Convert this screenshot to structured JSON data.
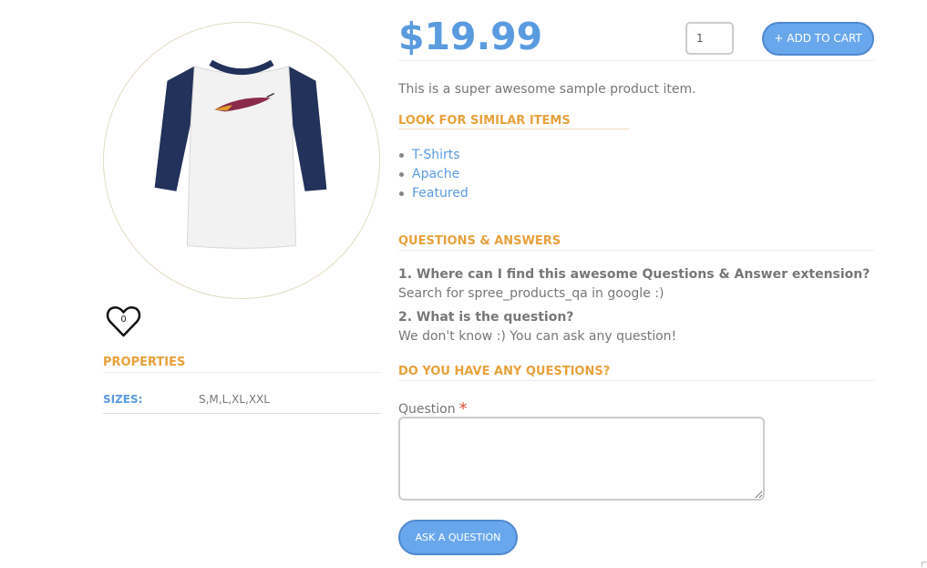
{
  "product": {
    "price": "$19.99",
    "quantity": "1",
    "add_to_cart_label": "ADD TO CART",
    "add_to_cart_icon": "plus-icon",
    "description": "This is a super awesome sample product item.",
    "image_icon": "tshirt-image",
    "wishlist": {
      "count": "0",
      "icon": "heart-icon"
    }
  },
  "properties": {
    "heading": "PROPERTIES",
    "rows": [
      {
        "key": "SIZES:",
        "value": "S,M,L,XL,XXL"
      }
    ]
  },
  "similar": {
    "heading": "LOOK FOR SIMILAR ITEMS",
    "items": [
      "T-Shirts",
      "Apache",
      "Featured"
    ]
  },
  "qa": {
    "heading": "QUESTIONS & ANSWERS",
    "entries": [
      {
        "question": "1. Where can I find this awesome Questions & Answer extension?",
        "answer": "Search for spree_products_qa in google :)"
      },
      {
        "question": "2. What is the question?",
        "answer": "We don't know :) You can ask any question!"
      }
    ]
  },
  "ask": {
    "heading": "DO YOU HAVE ANY QUESTIONS?",
    "question_label": "Question",
    "required_mark": "*",
    "textarea_value": "",
    "button_label": "ASK A QUESTION"
  },
  "colors": {
    "accent_blue": "#5a9be0",
    "button_blue": "#69a7ec",
    "heading_orange": "#e8a13c",
    "required_red": "#e0533a"
  }
}
